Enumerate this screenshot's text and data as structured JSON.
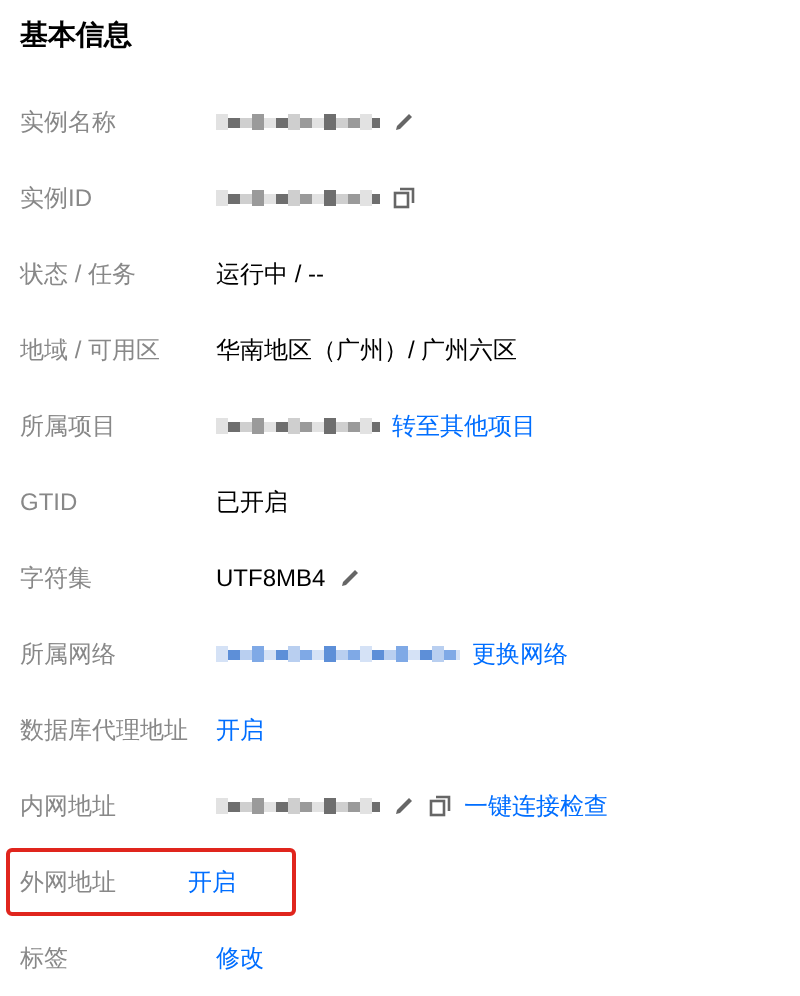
{
  "section_title": "基本信息",
  "rows": [
    {
      "label": "实例名称",
      "highlighted": false,
      "items": [
        {
          "kind": "redacted"
        },
        {
          "kind": "edit"
        }
      ]
    },
    {
      "label": "实例ID",
      "highlighted": false,
      "items": [
        {
          "kind": "redacted"
        },
        {
          "kind": "copy"
        }
      ]
    },
    {
      "label": "状态 / 任务",
      "highlighted": false,
      "items": [
        {
          "kind": "text",
          "text": "运行中 / --"
        }
      ]
    },
    {
      "label": "地域 / 可用区",
      "highlighted": false,
      "items": [
        {
          "kind": "text",
          "text": "华南地区（广州）/ 广州六区"
        }
      ]
    },
    {
      "label": "所属项目",
      "highlighted": false,
      "items": [
        {
          "kind": "redacted"
        },
        {
          "kind": "link",
          "text": "转至其他项目"
        }
      ]
    },
    {
      "label": "GTID",
      "highlighted": false,
      "items": [
        {
          "kind": "text",
          "text": "已开启"
        }
      ]
    },
    {
      "label": "字符集",
      "highlighted": false,
      "items": [
        {
          "kind": "text",
          "text": "UTF8MB4"
        },
        {
          "kind": "edit"
        }
      ]
    },
    {
      "label": "所属网络",
      "highlighted": false,
      "items": [
        {
          "kind": "redacted-link"
        },
        {
          "kind": "link",
          "text": "更换网络"
        }
      ]
    },
    {
      "label": "数据库代理地址",
      "highlighted": false,
      "items": [
        {
          "kind": "link",
          "text": "开启"
        }
      ]
    },
    {
      "label": "内网地址",
      "highlighted": false,
      "items": [
        {
          "kind": "redacted"
        },
        {
          "kind": "edit"
        },
        {
          "kind": "copy"
        },
        {
          "kind": "link",
          "text": "一键连接检查"
        }
      ]
    },
    {
      "label": "外网地址",
      "highlighted": true,
      "items": [
        {
          "kind": "link",
          "text": "开启"
        }
      ]
    },
    {
      "label": "标签",
      "highlighted": false,
      "items": [
        {
          "kind": "link",
          "text": "修改"
        }
      ]
    }
  ]
}
